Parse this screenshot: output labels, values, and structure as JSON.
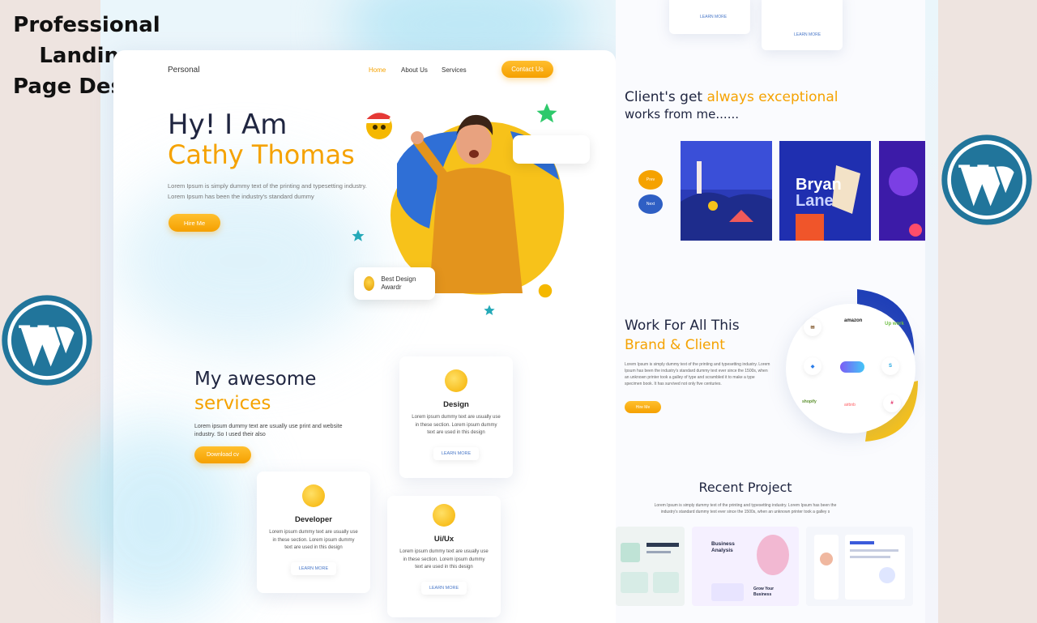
{
  "cover": {
    "title": "Professional Landing Page Design"
  },
  "logos": {
    "wordpress": "wordpress-logo"
  },
  "colors": {
    "accent": "#f5a200",
    "navy": "#1f2540",
    "wp_blue": "#21759b"
  },
  "nav": {
    "logo": "Personal",
    "home": "Home",
    "about": "About Us",
    "services": "Services",
    "contact": "Contact Us"
  },
  "hero": {
    "line1": "Hy! I Am",
    "line2": "Cathy Thomas",
    "desc": "Lorem Ipsum is simply dummy text of the printing and typesetting industry. Lorem Ipsum has been the industry's standard dummy",
    "hire": "Hire Me",
    "award": "Best Design Awardr"
  },
  "services": {
    "heading1": "My awesome",
    "heading2": "services",
    "desc": "Lorem ipsum dummy text are usually use print and website industry. So I used their also",
    "download": "Download cv",
    "cards": [
      {
        "title": "Design",
        "desc": "Lorem ipsum dummy text are usually use in these section. Lorem ipsum dummy text are used in this design",
        "link": "LEARN MORE"
      },
      {
        "title": "Developer",
        "desc": "Lorem ipsum dummy text are usually use in these section. Lorem ipsum dummy text are used in this design",
        "link": "LEARN MORE"
      },
      {
        "title": "Ui/Ux",
        "desc": "Lorem ipsum dummy text are usually use in these section. Lorem ipsum dummy text are used in this design",
        "link": "LEARN MORE"
      }
    ]
  },
  "right": {
    "top_links": [
      "LEARN MORE",
      "LEARN MORE"
    ],
    "clients_h1_a": "Client's get ",
    "clients_h1_b": "always exceptional",
    "clients_h2": "works from me......",
    "pills": [
      "Prev",
      "Next"
    ],
    "portfolio_brand_1": "Bryan",
    "portfolio_brand_2": "Lane",
    "work_h1": "Work For All This",
    "work_h2": "Brand & Client",
    "work_desc": "Lorem Ipsum is simply dummy text of the printing and typesetting industry. Lorem Ipsum has been the industry's standard dummy text ever since the 1500s, when an unknown printer took a galley of type and scrambled it to make a type specimen book. It has survived not only five centuries.",
    "work_hire": "Hire Me",
    "brands": [
      "amazon",
      "Up work",
      "shopify",
      "airbnb"
    ],
    "recent_title": "Recent Project",
    "recent_desc": "Lorem Ipsum is simply dummy text of the printing and typesetting industry. Lorem Ipsum has been the industry's standard dummy text ever since the 1500s, when an unknown printer took a galley s",
    "proj_business": "Business Analysis",
    "proj_grow": "Grow Your Business"
  }
}
